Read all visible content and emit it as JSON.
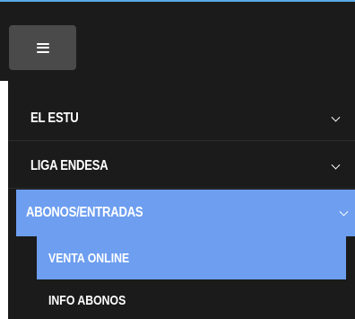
{
  "header": {
    "menu_icon": "hamburger-menu-icon"
  },
  "menu": {
    "items": [
      {
        "label": "EL ESTU",
        "icon": "chevron-down-icon",
        "expanded": false
      },
      {
        "label": "LIGA ENDESA",
        "icon": "chevron-down-icon",
        "expanded": false
      },
      {
        "label": "ABONOS/ENTRADAS",
        "icon": "chevron-down-icon",
        "expanded": true,
        "active": true
      }
    ],
    "submenu": [
      {
        "label": "VENTA ONLINE",
        "active": true
      },
      {
        "label": "INFO ABONOS",
        "active": false
      }
    ]
  },
  "colors": {
    "background": "#1b1b1b",
    "active": "#6d9ef0",
    "hamburger": "#4a4a4a",
    "top_border": "#5aa9e6",
    "text": "#ffffff"
  }
}
